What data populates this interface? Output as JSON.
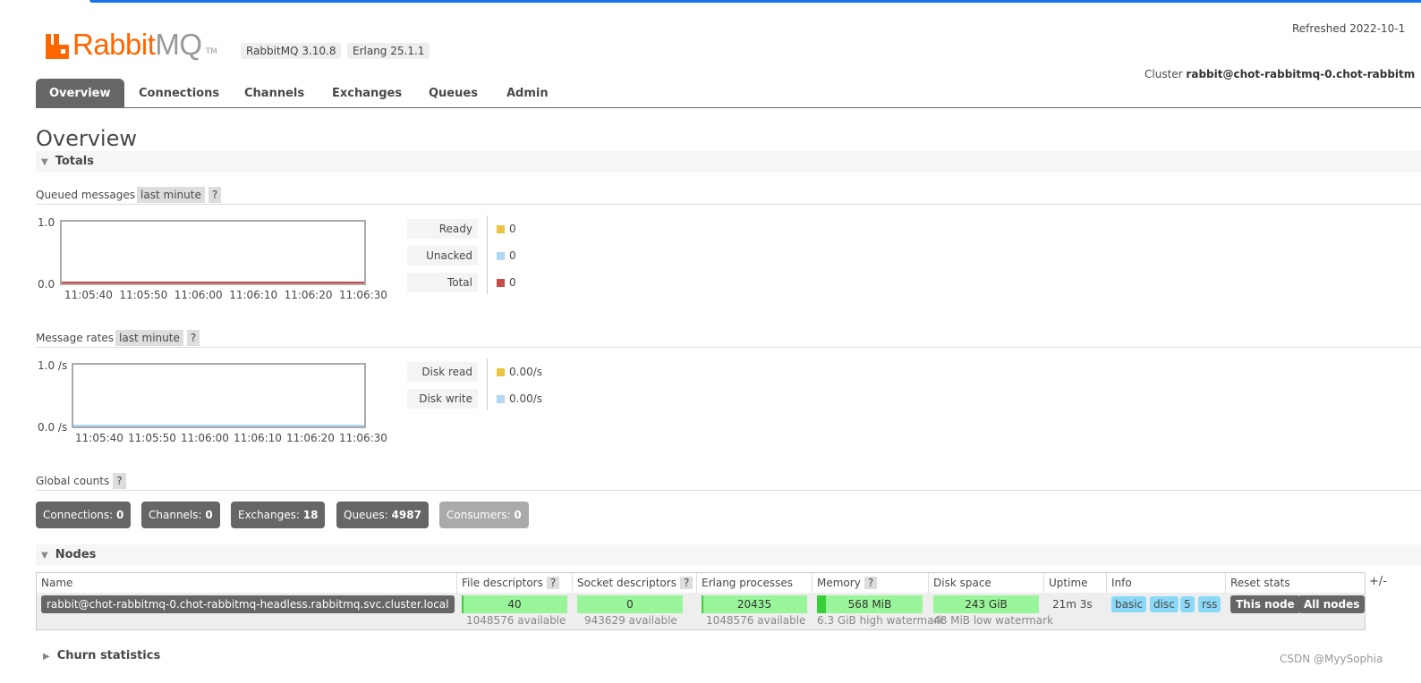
{
  "header": {
    "logo_rabbit": "Rabbit",
    "logo_mq": "MQ",
    "logo_tm": "TM",
    "version": "RabbitMQ 3.10.8",
    "erlang": "Erlang 25.1.1",
    "refreshed": "Refreshed 2022-10-1",
    "cluster_label": "Cluster",
    "cluster_name": "rabbit@chot-rabbitmq-0.chot-rabbitm"
  },
  "tabs": [
    "Overview",
    "Connections",
    "Channels",
    "Exchanges",
    "Queues",
    "Admin"
  ],
  "page_title": "Overview",
  "totals": {
    "heading": "Totals",
    "queued": {
      "title": "Queued messages",
      "range": "last minute",
      "help": "?",
      "y_top": "1.0",
      "y_bottom": "0.0",
      "x_ticks": [
        "11:05:40",
        "11:05:50",
        "11:06:00",
        "11:06:10",
        "11:06:20",
        "11:06:30"
      ],
      "legend": [
        {
          "label": "Ready",
          "value": "0",
          "color": "#edc240"
        },
        {
          "label": "Unacked",
          "value": "0",
          "color": "#afd8f8"
        },
        {
          "label": "Total",
          "value": "0",
          "color": "#cb4b4b"
        }
      ]
    },
    "rates": {
      "title": "Message rates",
      "range": "last minute",
      "help": "?",
      "y_top": "1.0 /s",
      "y_bottom": "0.0 /s",
      "x_ticks": [
        "11:05:40",
        "11:05:50",
        "11:06:00",
        "11:06:10",
        "11:06:20",
        "11:06:30"
      ],
      "legend": [
        {
          "label": "Disk read",
          "value": "0.00/s",
          "color": "#edc240"
        },
        {
          "label": "Disk write",
          "value": "0.00/s",
          "color": "#afd8f8"
        }
      ]
    },
    "global": {
      "title": "Global counts",
      "help": "?",
      "counts": [
        {
          "label": "Connections:",
          "value": "0"
        },
        {
          "label": "Channels:",
          "value": "0"
        },
        {
          "label": "Exchanges:",
          "value": "18"
        },
        {
          "label": "Queues:",
          "value": "4987"
        },
        {
          "label": "Consumers:",
          "value": "0"
        }
      ]
    }
  },
  "nodes": {
    "heading": "Nodes",
    "plus_minus": "+/-",
    "columns": [
      "Name",
      "File descriptors",
      "Socket descriptors",
      "Erlang processes",
      "Memory",
      "Disk space",
      "Uptime",
      "Info",
      "Reset stats"
    ],
    "help": "?",
    "row": {
      "name": "rabbit@chot-rabbitmq-0.chot-rabbitmq-headless.rabbitmq.svc.cluster.local",
      "fd_used": "40",
      "fd_avail": "1048576 available",
      "fd_fraction": 4e-05,
      "sock_used": "0",
      "sock_avail": "943629 available",
      "sock_fraction": 0,
      "proc_used": "20435",
      "proc_avail": "1048576 available",
      "proc_fraction": 0.0195,
      "mem_used": "568 MiB",
      "mem_note": "6.3 GiB high watermark",
      "mem_fraction": 0.088,
      "disk_used": "243 GiB",
      "disk_note": "48 MiB low watermark",
      "uptime": "21m 3s",
      "info_tags": [
        "basic",
        "disc",
        "5",
        "rss"
      ],
      "reset_this": "This node",
      "reset_all": "All nodes"
    }
  },
  "churn": {
    "heading": "Churn statistics"
  },
  "watermark": "CSDN @MyySophia"
}
